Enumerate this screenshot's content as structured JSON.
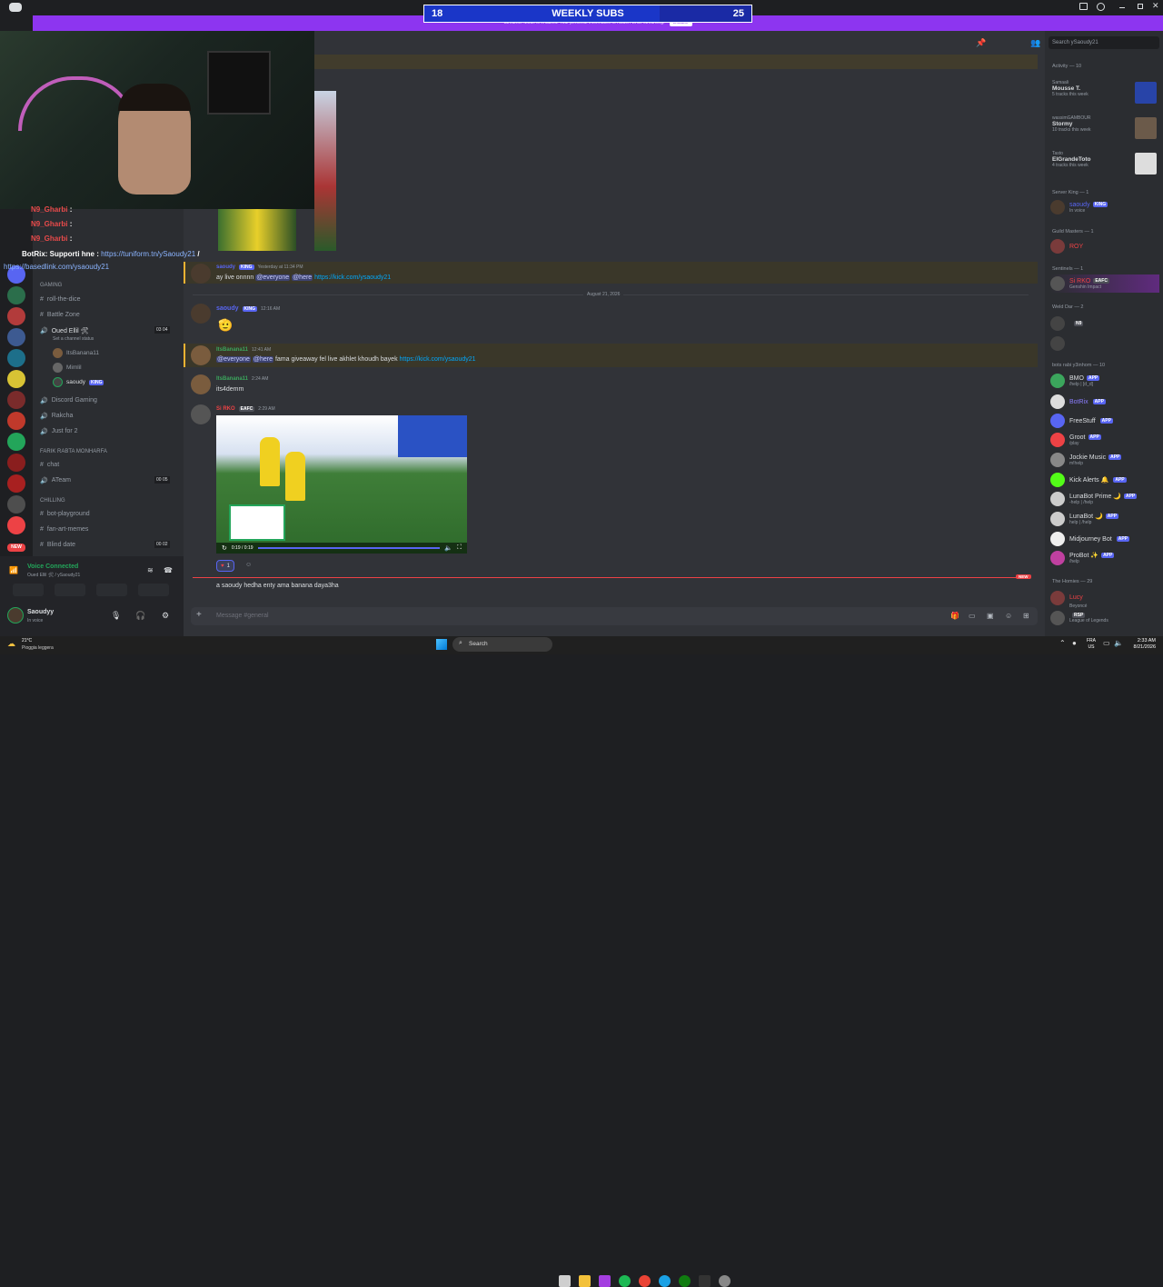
{
  "overlay": {
    "subs_left": "18",
    "subs_title": "WEEKLY SUBS",
    "subs_right": "25",
    "subs_fill": 0.72,
    "banner_text": "Streamer Mode is enabled. Your personal information is hidden while streaming.",
    "banner_button": "Disable",
    "chat_lines": [
      {
        "user": "N9_Gharbi",
        "text": " :",
        "color": "#e84a4a"
      },
      {
        "user": "N9_Gharbi",
        "text": " :",
        "color": "#e84a4a"
      },
      {
        "user": "N9_Gharbi",
        "text": " :",
        "color": "#e84a4a"
      }
    ],
    "botrix_user": "BotRix",
    "botrix_text": ": Supporti hne : ",
    "botrix_link": "https://tuniform.tn/ySaoudy21",
    "botrix_slash": " /",
    "botrix_link2": "https://basedlink.com/ysaoudy21"
  },
  "server": {
    "categories": [
      {
        "label": "GAMING",
        "channels": [
          {
            "type": "text",
            "name": "roll-the-dice"
          },
          {
            "type": "text",
            "name": "Battle Zone"
          },
          {
            "type": "voice",
            "name": "Oued Ellil 🛠",
            "status": "Set a channel status",
            "counts": [
              "03",
              "04"
            ]
          }
        ]
      },
      {
        "label": "FARIK RABTA MONHARFA",
        "channels": []
      },
      {
        "label": "CHILLING",
        "channels": []
      }
    ],
    "voice_users": [
      "ItsBanana11",
      "Mimlil",
      "saoudy"
    ],
    "voice_user_badge": "KING",
    "more_channels": [
      {
        "type": "voice",
        "name": "Discord Gaming"
      },
      {
        "type": "voice",
        "name": "Rakcha"
      },
      {
        "type": "voice",
        "name": "Just for 2"
      },
      {
        "type": "text",
        "name": "chat"
      },
      {
        "type": "voice",
        "name": "ATeam",
        "counts": [
          "00",
          "05"
        ]
      },
      {
        "type": "text",
        "name": "bot-playground"
      },
      {
        "type": "text",
        "name": "fan-art-memes"
      },
      {
        "type": "text",
        "name": "Blind date",
        "counts": [
          "00",
          "02"
        ]
      }
    ],
    "voice_connected": "Voice Connected",
    "voice_location": "Oued Ellil 🛠 / ySaoudy21",
    "user_name": "Saoudyy",
    "user_status": "In voice"
  },
  "chat": {
    "messages": [
      {
        "name": "saoudy",
        "badge": "KING",
        "time": "Yesterday at 11:34 PM",
        "text": "ay live onnnn",
        "mentions": [
          "@everyone",
          "@here"
        ],
        "link": "https://kick.com/ysaoudy21",
        "name_color": "#5865f2"
      },
      {
        "name": "saoudy",
        "badge": "KING",
        "time": "12:16 AM",
        "text": "🫡",
        "name_color": "#5865f2"
      },
      {
        "name": "ItsBanana11",
        "time": "12:41 AM",
        "mentions": [
          "@everyone",
          "@here"
        ],
        "text": "fama giveaway fel live akhlet khoudh bayek",
        "link": "https://kick.com/ysaoudy21",
        "name_color": "#3ba55c"
      },
      {
        "name": "ItsBanana11",
        "time": "2:24 AM",
        "text": "its4demm",
        "name_color": "#3ba55c"
      },
      {
        "name": "Si RKO",
        "badge": "EAFC",
        "time": "2:29 AM",
        "name_color": "#ed4245"
      }
    ],
    "date_divider": "August 21, 2026",
    "video_time": "0:19 / 0:19",
    "reaction_count": "1",
    "last_message": "a saoudy hedha enty ama banana daya3ha",
    "new_label": "NEW",
    "composer_placeholder": "Message #general"
  },
  "members": {
    "search_placeholder": "Search ySaoudy21",
    "activity_label": "Activity — 10",
    "activity": [
      {
        "user": "Samaali",
        "title": "Mousse T.",
        "sub": "5 tracks this week"
      },
      {
        "user": "wassimGAMBOUR",
        "title": "Stormy",
        "sub": "10 tracks this week"
      },
      {
        "user": "Tasto",
        "title": "ElGrandeToto",
        "sub": "4 tracks this week"
      }
    ],
    "groups": [
      {
        "label": "Server King — 1",
        "members": [
          {
            "name": "saoudy",
            "badge": "KING",
            "status": "In voice",
            "color": "#5865f2"
          }
        ]
      },
      {
        "label": "Guild Masters — 1",
        "members": [
          {
            "name": "ROY",
            "color": "#ed4245"
          }
        ]
      },
      {
        "label": "Sentinels — 1",
        "members": [
          {
            "name": "Si RKO",
            "badge": "EAFC",
            "status": "Genshin Impact",
            "color": "#ed4245"
          }
        ]
      },
      {
        "label": "Weld Dar — 2",
        "members": [
          {
            "name": "",
            "badge": "N9",
            "color": "#ed4245"
          },
          {
            "name": "",
            "color": "#ed4245"
          }
        ]
      },
      {
        "label": "bots rabi y3inhom — 10",
        "members": [
          {
            "name": "BMO",
            "badge": "APP",
            "status": "/help | [d_d]",
            "color": "#dbdee1"
          },
          {
            "name": "BotRix",
            "badge": "APP",
            "color": "#8b7dff"
          },
          {
            "name": "FreeStuff",
            "badge": "APP",
            "color": "#dbdee1"
          },
          {
            "name": "Groot",
            "badge": "APP",
            "status": "/play",
            "color": "#dbdee1"
          },
          {
            "name": "Jockie Music",
            "badge": "APP",
            "status": "m!help",
            "color": "#dbdee1"
          },
          {
            "name": "Kick Alerts 🔔",
            "badge": "APP",
            "color": "#dbdee1"
          },
          {
            "name": "LunaBot Prime 🌙",
            "badge": "APP",
            "status": "-help | /help",
            "color": "#dbdee1"
          },
          {
            "name": "LunaBot 🌙",
            "badge": "APP",
            "status": "help | /help",
            "color": "#dbdee1"
          },
          {
            "name": "Midjourney Bot",
            "badge": "APP",
            "color": "#dbdee1"
          },
          {
            "name": "ProBot ✨",
            "badge": "APP",
            "status": "/help",
            "color": "#dbdee1"
          }
        ]
      },
      {
        "label": "The Homies — 29",
        "members": [
          {
            "name": "Lucy",
            "status": "Beyoncé",
            "color": "#ed4245"
          },
          {
            "name": "",
            "badge": "RSP",
            "status": "League of Legends",
            "color": "#dbdee1"
          }
        ]
      }
    ]
  },
  "taskbar": {
    "weather_temp": "21°C",
    "weather_desc": "Pioggia leggera",
    "search_label": "Search",
    "lang": "FRA",
    "region": "US",
    "time": "2:33 AM",
    "date": "8/21/2026"
  },
  "colors": {
    "accent": "#8d35f0",
    "blurple": "#5865f2",
    "green": "#23a55a",
    "red": "#ed4245"
  }
}
